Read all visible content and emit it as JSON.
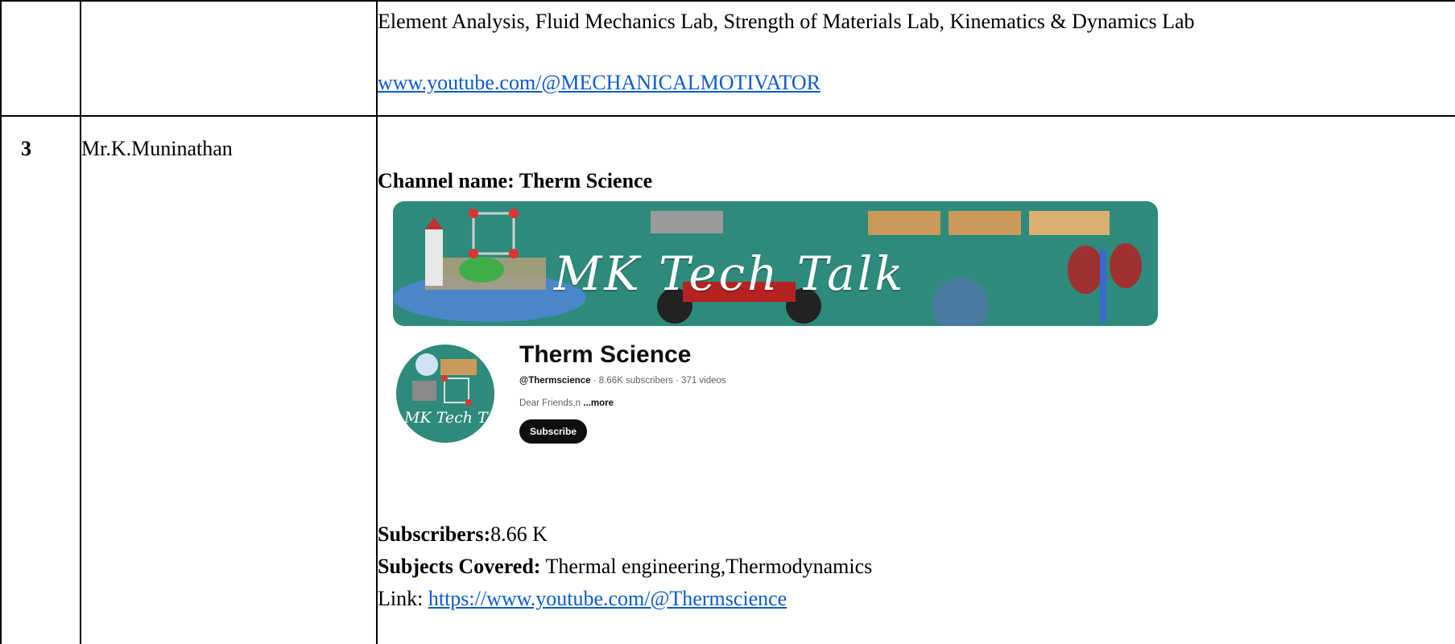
{
  "row_prev": {
    "subjects_tail": "Element Analysis, Fluid Mechanics Lab, Strength of Materials Lab, Kinematics & Dynamics Lab",
    "link": "www.youtube.com/@MECHANICALMOTIVATOR"
  },
  "row3": {
    "sno": "3",
    "name": "Mr.K.Muninathan",
    "channel_label": "Channel name: Therm Science",
    "banner_text": "MK Tech Talk",
    "avatar_text": "MK Tech Talk",
    "yt": {
      "title": "Therm Science",
      "handle": "@Thermscience",
      "meta": " · 8.66K subscribers · 371 videos",
      "desc": "Dear Friends,n ",
      "more": "...more",
      "subscribe": "Subscribe"
    },
    "subscribers_label": "Subscribers:",
    "subscribers_value": "8.66 K",
    "subjects_label": "Subjects Covered:",
    "subjects_value": " Thermal engineering,Thermodynamics",
    "link_label": "Link: ",
    "link": "https://www.youtube.com/@Thermscience"
  },
  "colors": {
    "banner_bg": "#2e8a7a",
    "link": "#0b5bd3",
    "button_bg": "#0f0f0f"
  }
}
